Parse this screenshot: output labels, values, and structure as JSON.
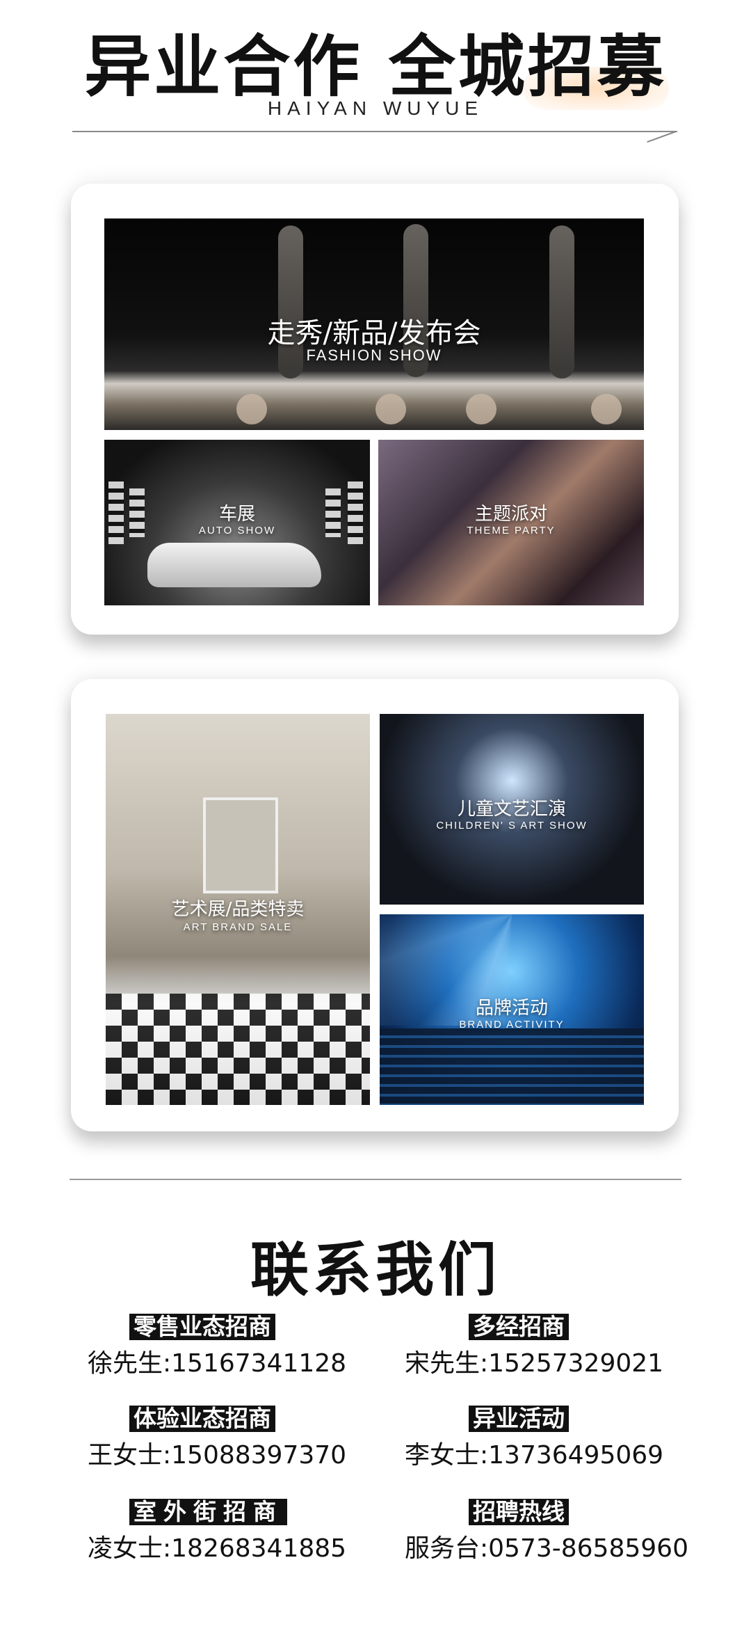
{
  "header": {
    "title": "异业合作 全城招募",
    "subtitle": "HAIYAN WUYUE"
  },
  "gallery": {
    "fashion": {
      "title_zh": "走秀/新品/发布会",
      "title_en": "FASHION SHOW"
    },
    "auto": {
      "title_zh": "车展",
      "title_en": "AUTO SHOW"
    },
    "party": {
      "title_zh": "主题派对",
      "title_en": "THEME PARTY"
    },
    "art": {
      "title_zh": "艺术展/品类特卖",
      "title_en": "ART BRAND SALE"
    },
    "children": {
      "title_zh": "儿童文艺汇演",
      "title_en": "CHILDREN' S ART SHOW"
    },
    "brand": {
      "title_zh": "品牌活动",
      "title_en": "BRAND ACTIVITY"
    }
  },
  "contact": {
    "title": "联系我们",
    "items": [
      {
        "label": "零售业态招商",
        "phone": "徐先生:15167341128"
      },
      {
        "label": "多经招商",
        "phone": "宋先生:15257329021"
      },
      {
        "label": "体验业态招商",
        "phone": "王女士:15088397370"
      },
      {
        "label": "异业活动",
        "phone": "李女士:13736495069"
      },
      {
        "label": "室外街招商",
        "phone": "凌女士:18268341885"
      },
      {
        "label": "招聘热线",
        "phone": "服务台:0573-86585960"
      }
    ]
  }
}
